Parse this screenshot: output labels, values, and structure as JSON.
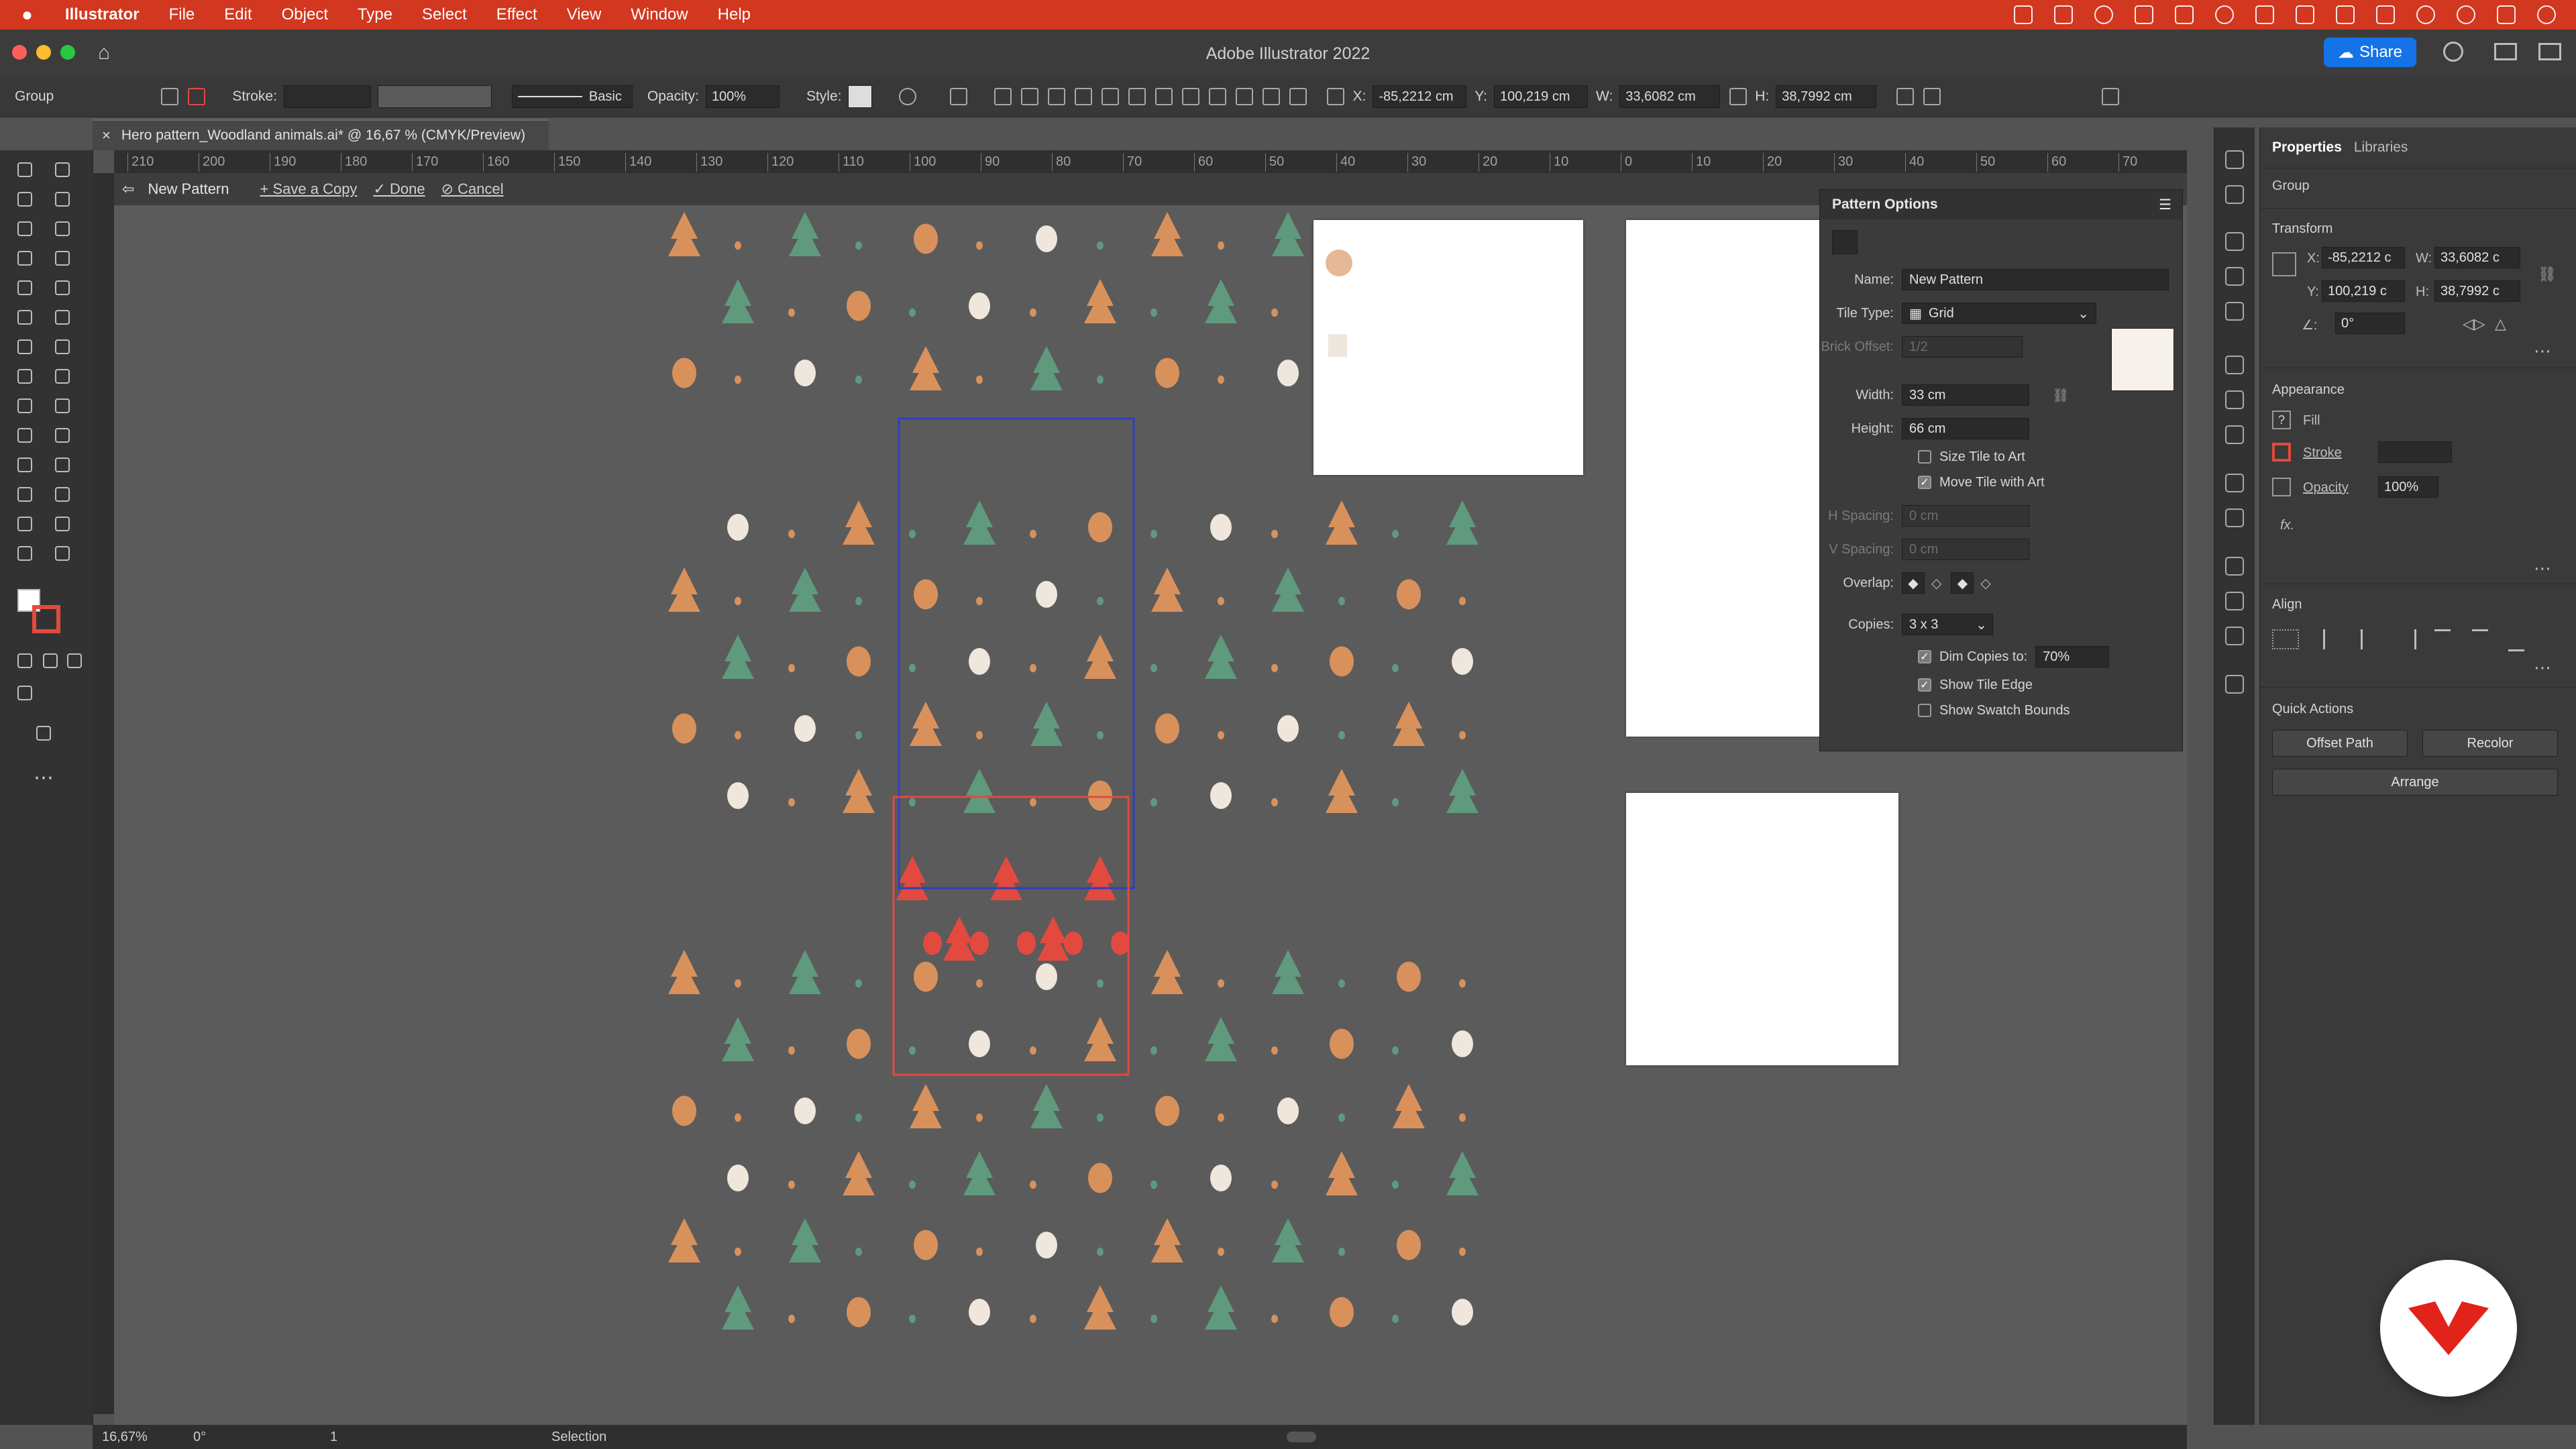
{
  "menubar": {
    "app": "Illustrator",
    "items": [
      "File",
      "Edit",
      "Object",
      "Type",
      "Select",
      "Effect",
      "View",
      "Window",
      "Help"
    ]
  },
  "titlebar": {
    "title": "Adobe Illustrator 2022",
    "share": "Share"
  },
  "control": {
    "selection": "Group",
    "stroke_label": "Stroke:",
    "brush": "Basic",
    "opacity_label": "Opacity:",
    "opacity": "100%",
    "style_label": "Style:",
    "x_label": "X:",
    "x": "-85,2212 cm",
    "y_label": "Y:",
    "y": "100,219 cm",
    "w_label": "W:",
    "w": "33,6082 cm",
    "h_label": "H:",
    "h": "38,7992 cm"
  },
  "document": {
    "tab": "Hero pattern_Woodland animals.ai* @ 16,67 % (CMYK/Preview)"
  },
  "ruler": {
    "ticks": [
      "210",
      "200",
      "190",
      "180",
      "170",
      "160",
      "150",
      "140",
      "130",
      "120",
      "110",
      "100",
      "90",
      "80",
      "70",
      "60",
      "50",
      "40",
      "30",
      "20",
      "10",
      "0",
      "10",
      "20",
      "30",
      "40",
      "50",
      "60",
      "70"
    ]
  },
  "pattern_bar": {
    "name": "New Pattern",
    "save": "Save a Copy",
    "done": "Done",
    "cancel": "Cancel"
  },
  "pattern_options": {
    "title": "Pattern Options",
    "name_label": "Name:",
    "name": "New Pattern",
    "tile_type_label": "Tile Type:",
    "tile_type": "Grid",
    "brick_label": "Brick Offset:",
    "brick": "1/2",
    "width_label": "Width:",
    "width": "33 cm",
    "height_label": "Height:",
    "height": "66 cm",
    "size_tile": "Size Tile to Art",
    "move_tile": "Move Tile with Art",
    "hspacing_label": "H Spacing:",
    "hspacing": "0 cm",
    "vspacing_label": "V Spacing:",
    "vspacing": "0 cm",
    "overlap_label": "Overlap:",
    "copies_label": "Copies:",
    "copies": "3 x 3",
    "dim_copies": "Dim Copies to:",
    "dim_value": "70%",
    "show_edge": "Show Tile Edge",
    "show_bounds": "Show Swatch Bounds"
  },
  "properties": {
    "tabs": [
      "Properties",
      "Libraries"
    ],
    "group": "Group",
    "transform": "Transform",
    "x": "-85,2212 c",
    "w": "33,6082 c",
    "y": "100,219 c",
    "h": "38,7992 c",
    "angle": "0°",
    "appearance": "Appearance",
    "fill": "Fill",
    "stroke": "Stroke",
    "opacity": "Opacity",
    "opacity_value": "100%",
    "fx": "fx.",
    "align": "Align",
    "quick_actions": "Quick Actions",
    "offset_path": "Offset Path",
    "recolor": "Recolor",
    "arrange": "Arrange"
  },
  "status": {
    "zoom": "16,67%",
    "angle": "0°",
    "page": "1",
    "tool": "Selection"
  },
  "colors": {
    "accent": "#d2371f",
    "orange": "#d9915c",
    "green": "#5f9a7d",
    "red": "#e24a3f",
    "cream": "#efe6dc"
  }
}
